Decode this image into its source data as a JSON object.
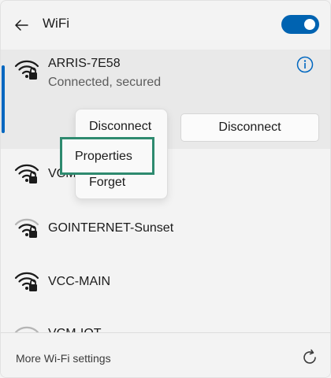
{
  "header": {
    "title": "WiFi",
    "back_icon": "arrow-left-icon",
    "toggle_on": true,
    "toggle_color": "#0063b1"
  },
  "connected": {
    "name": "ARRIS-7E58",
    "status": "Connected, secured",
    "icon": "wifi-secured-icon",
    "info_icon": "info-icon",
    "disconnect_label": "Disconnect",
    "accent_color": "#0067c0"
  },
  "context_menu": {
    "items": [
      {
        "label": "Disconnect"
      },
      {
        "label": "Properties",
        "highlighted": true
      },
      {
        "label": "Forget"
      }
    ],
    "highlight_color": "#2e8a6f"
  },
  "networks": [
    {
      "name": "VCM",
      "icon": "wifi-secured-icon"
    },
    {
      "name": "GOINTERNET-Sunset",
      "icon": "wifi-secured-icon"
    },
    {
      "name": "VCC-MAIN",
      "icon": "wifi-secured-icon"
    },
    {
      "name": "VCM-IOT",
      "icon": "wifi-secured-icon"
    }
  ],
  "footer": {
    "more_settings_label": "More Wi-Fi settings",
    "refresh_icon": "refresh-icon"
  }
}
